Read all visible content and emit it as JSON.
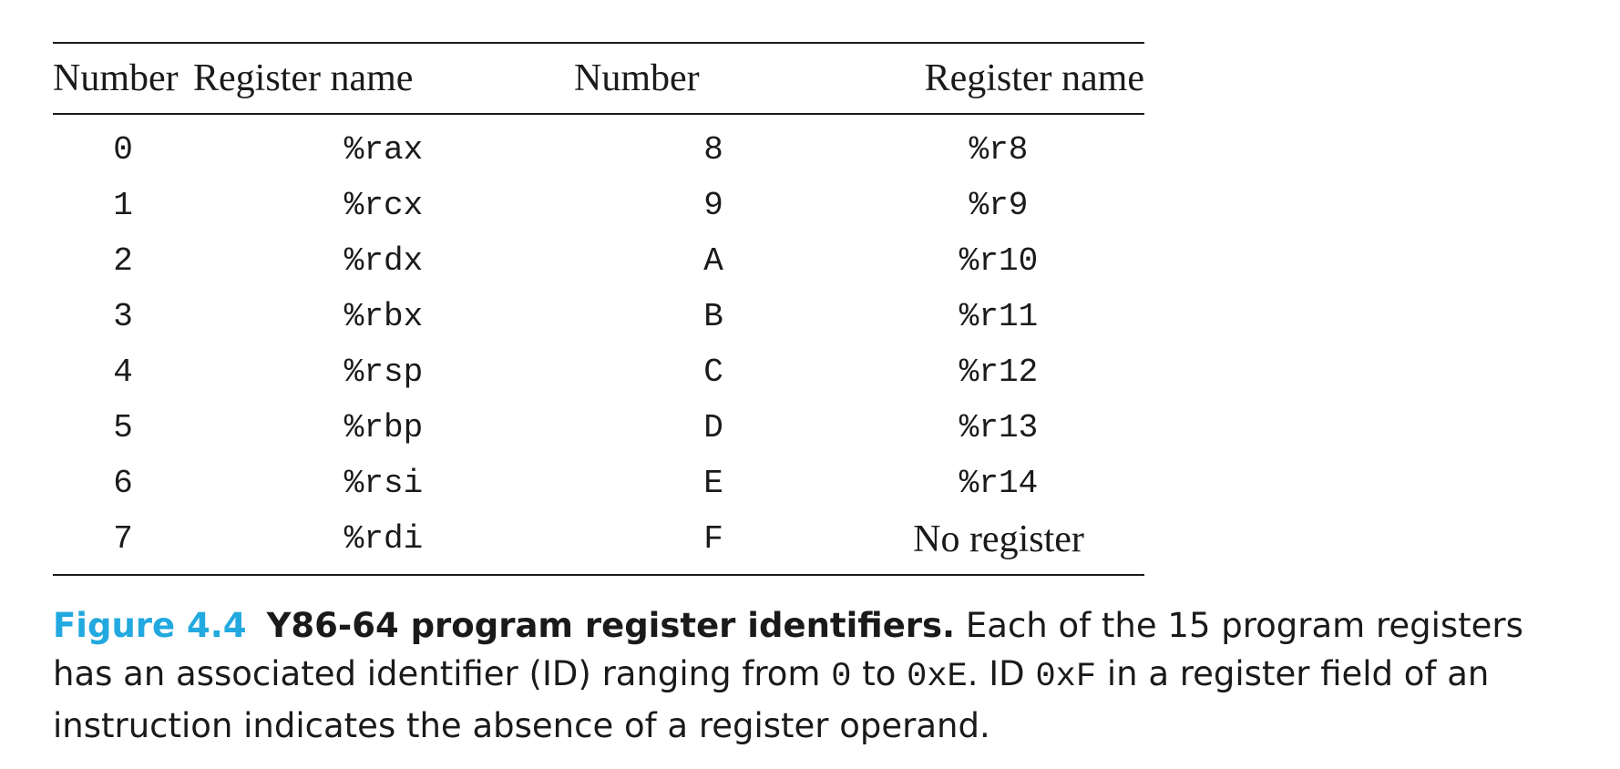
{
  "table": {
    "headers": [
      "Number",
      "Register name",
      "Number",
      "Register name"
    ],
    "rows": [
      [
        "0",
        "%rax",
        "8",
        "%r8"
      ],
      [
        "1",
        "%rcx",
        "9",
        "%r9"
      ],
      [
        "2",
        "%rdx",
        "A",
        "%r10"
      ],
      [
        "3",
        "%rbx",
        "B",
        "%r11"
      ],
      [
        "4",
        "%rsp",
        "C",
        "%r12"
      ],
      [
        "5",
        "%rbp",
        "D",
        "%r13"
      ],
      [
        "6",
        "%rsi",
        "E",
        "%r14"
      ],
      [
        "7",
        "%rdi",
        "F",
        "No register"
      ]
    ]
  },
  "caption": {
    "label": "Figure 4.4",
    "title": "Y86-64 program register identifiers.",
    "text_1": " Each of the 15 program registers has an associated identifier (ID) ranging from ",
    "code_1": "0",
    "text_2": " to ",
    "code_2": "0xE",
    "text_3": ". ID ",
    "code_3": "0xF",
    "text_4": " in a register field of an instruction indicates the absence of a register operand."
  },
  "colors": {
    "figure_label": "#22a9e0",
    "text": "#1a1a1a"
  }
}
